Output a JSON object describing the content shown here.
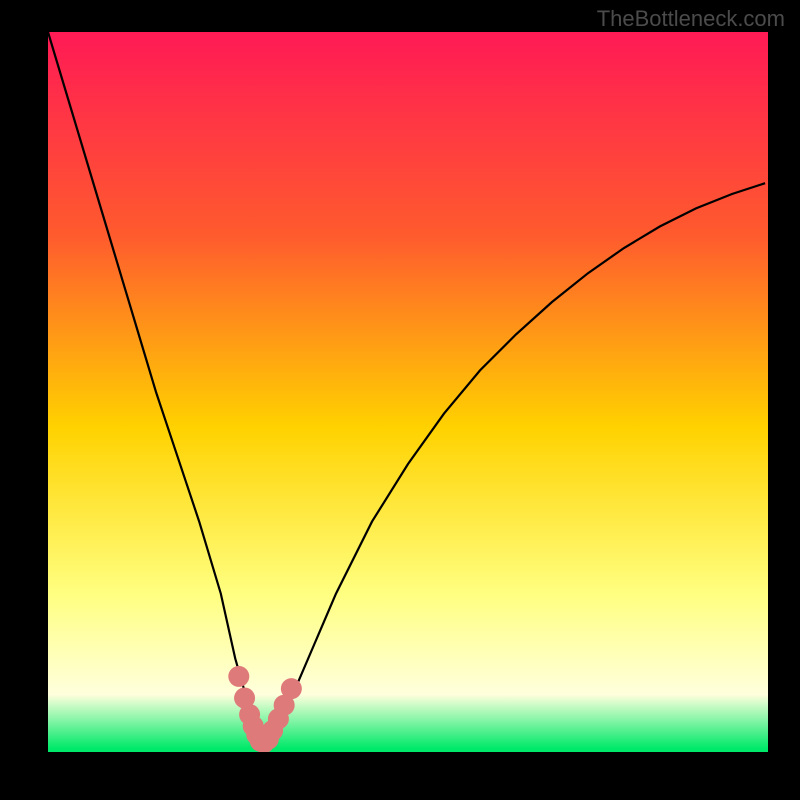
{
  "watermark": "TheBottleneck.com",
  "colors": {
    "frame": "#000000",
    "grad_top": "#ff1a55",
    "grad_upper": "#ff5a2e",
    "grad_mid": "#ffd200",
    "grad_lower": "#ffff80",
    "grad_pale": "#ffffdd",
    "grad_green": "#00e96a",
    "curve": "#000000",
    "marker_fill": "#df7a7a",
    "marker_stroke": "#b04a4a"
  },
  "chart_data": {
    "type": "line",
    "title": "",
    "xlabel": "",
    "ylabel": "",
    "xlim": [
      0,
      100
    ],
    "ylim": [
      0,
      100
    ],
    "series": [
      {
        "name": "bottleneck-curve",
        "x_percent": [
          0,
          3,
          6,
          9,
          12,
          15,
          18,
          21,
          24,
          26,
          28,
          29,
          30,
          31,
          32,
          34,
          37,
          40,
          45,
          50,
          55,
          60,
          65,
          70,
          75,
          80,
          85,
          90,
          95,
          99.6
        ],
        "y_percent": [
          100,
          90,
          80,
          70,
          60,
          50,
          41,
          32,
          22,
          13,
          6,
          2.5,
          1,
          2,
          4,
          8,
          15,
          22,
          32,
          40,
          47,
          53,
          58,
          62.5,
          66.5,
          70,
          73,
          75.5,
          77.5,
          79
        ]
      }
    ],
    "marker_region": {
      "name": "low-bottleneck-markers",
      "x_percent": [
        26.5,
        27.3,
        28.0,
        28.5,
        29.0,
        29.5,
        30.0,
        30.6,
        31.2,
        32.0,
        32.8,
        33.8
      ],
      "y_percent": [
        10.5,
        7.5,
        5.2,
        3.6,
        2.4,
        1.5,
        1.3,
        1.8,
        3.0,
        4.6,
        6.5,
        8.8
      ]
    },
    "legend": [],
    "grid": false
  }
}
